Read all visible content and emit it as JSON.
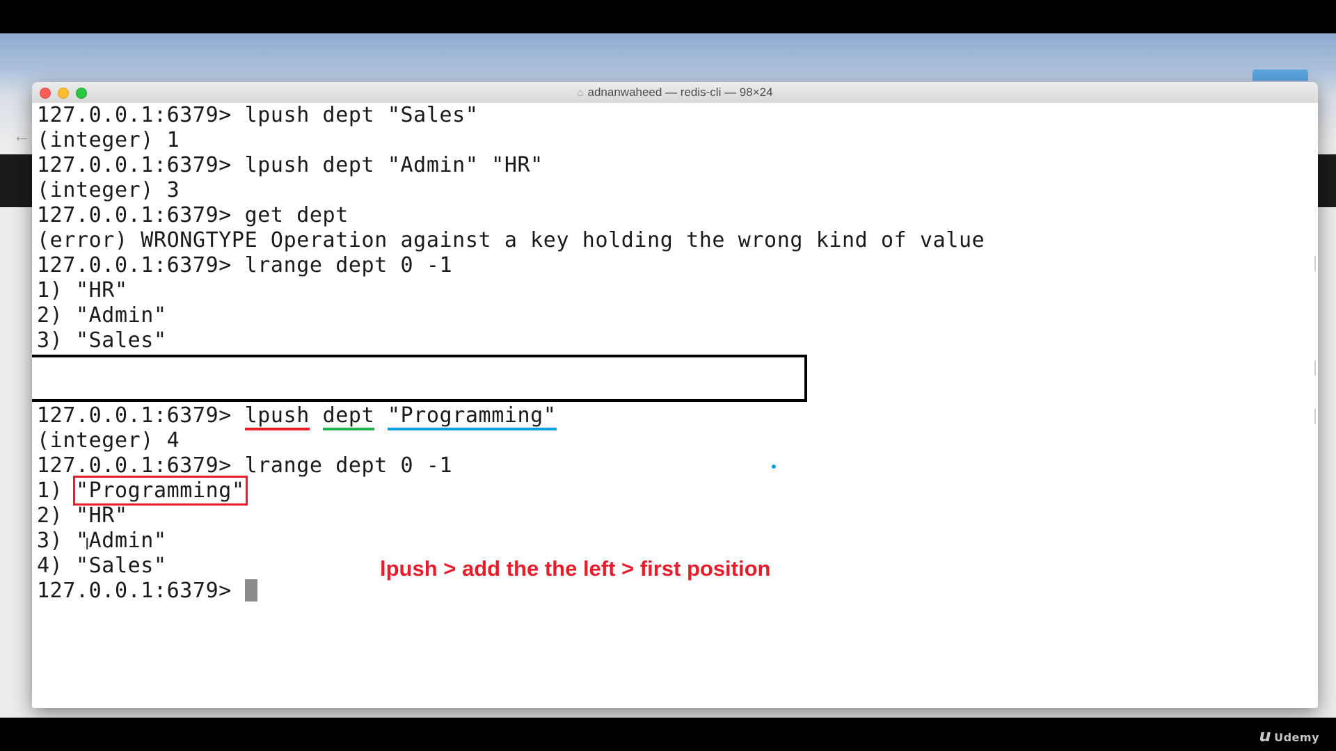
{
  "window": {
    "title": "adnanwaheed — redis-cli — 98×24",
    "home_icon": "home-icon"
  },
  "terminal": {
    "lines": [
      "127.0.0.1:6379> lpush dept \"Sales\"",
      "(integer) 1",
      "127.0.0.1:6379> lpush dept \"Admin\" \"HR\"",
      "(integer) 3",
      "127.0.0.1:6379> get dept",
      "(error) WRONGTYPE Operation against a key holding the wrong kind of value",
      "127.0.0.1:6379> lrange dept 0 -1",
      "1) \"HR\"",
      "2) \"Admin\"",
      "3) \"Sales\""
    ],
    "highlight_line": {
      "prompt": "127.0.0.1:6379> ",
      "cmd": "lpush",
      "key": "dept",
      "value": "\"Programming\""
    },
    "lines_after": [
      "(integer) 4",
      "127.0.0.1:6379> lrange dept 0 -1"
    ],
    "result_first": {
      "index": "1) ",
      "value": "\"Programming\""
    },
    "result_rest": [
      "2) \"HR\"",
      "3) \"Admin\"",
      "4) \"Sales\""
    ],
    "final_prompt": "127.0.0.1:6379> "
  },
  "annotation": {
    "text": "lpush > add the the left > first position",
    "color": "#e81d2b"
  },
  "colors": {
    "underline_command": "#e81d2b",
    "underline_key": "#22b14c",
    "underline_value": "#0aa2e6"
  },
  "branding": {
    "logo_text": "Udemy"
  }
}
